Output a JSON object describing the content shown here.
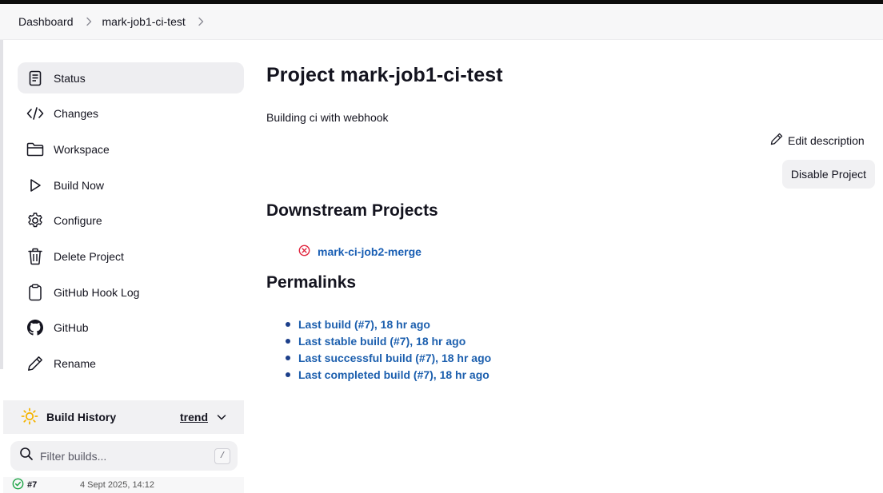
{
  "breadcrumbs": [
    {
      "label": "Dashboard"
    },
    {
      "label": "mark-job1-ci-test"
    }
  ],
  "sidebar": {
    "items": [
      {
        "label": "Status",
        "icon": "status-document-icon"
      },
      {
        "label": "Changes",
        "icon": "code-icon"
      },
      {
        "label": "Workspace",
        "icon": "folder-icon"
      },
      {
        "label": "Build Now",
        "icon": "play-icon"
      },
      {
        "label": "Configure",
        "icon": "gear-icon"
      },
      {
        "label": "Delete Project",
        "icon": "trash-icon"
      },
      {
        "label": "GitHub Hook Log",
        "icon": "clipboard-icon"
      },
      {
        "label": "GitHub",
        "icon": "github-icon"
      },
      {
        "label": "Rename",
        "icon": "pencil-icon"
      }
    ],
    "active_item": "Status"
  },
  "build_history": {
    "title": "Build History",
    "trend_label": "trend",
    "filter_placeholder": "Filter builds...",
    "filter_shortcut": "/",
    "builds": [
      {
        "number": "#7",
        "date": "4 Sept 2025, 14:12",
        "status": "success"
      }
    ]
  },
  "main": {
    "title": "Project mark-job1-ci-test",
    "description": "Building ci with webhook",
    "edit_description_label": "Edit description",
    "disable_button_label": "Disable Project",
    "downstream_title": "Downstream Projects",
    "downstream_projects": [
      {
        "label": "mark-ci-job2-merge",
        "status": "failed"
      }
    ],
    "permalinks_title": "Permalinks",
    "permalinks": [
      {
        "label": "Last build (#7), 18 hr ago"
      },
      {
        "label": "Last stable build (#7), 18 hr ago"
      },
      {
        "label": "Last successful build (#7), 18 hr ago"
      },
      {
        "label": "Last completed build (#7), 18 hr ago"
      }
    ]
  },
  "colors": {
    "link": "#1c5fae",
    "failed": "#e0243d",
    "success": "#1ea446",
    "sun": "#f5b400",
    "active_bg": "#eeeef1"
  }
}
